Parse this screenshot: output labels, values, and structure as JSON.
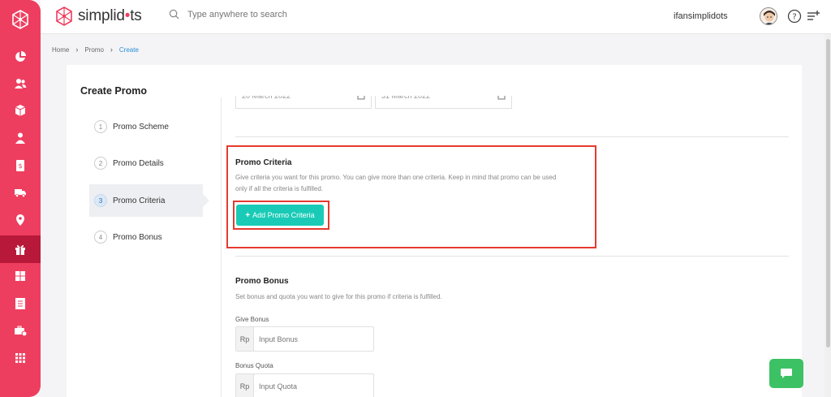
{
  "brand": {
    "name_prefix": "simplid",
    "name_dot": "•",
    "name_suffix": "ts",
    "accent_color": "#ee3e5f",
    "logo_icon": "network-hexagon-logo"
  },
  "search": {
    "placeholder": "Type anywhere to search",
    "icon": "search-icon"
  },
  "user": {
    "username": "ifansimplidots",
    "avatar_icon": "avatar-icon",
    "help_icon": "help-icon",
    "menu_icon": "menu-add-icon"
  },
  "sidebar": {
    "items": [
      {
        "icon": "pie-chart-icon"
      },
      {
        "icon": "users-icon"
      },
      {
        "icon": "box-icon"
      },
      {
        "icon": "user-badge-icon"
      },
      {
        "icon": "invoice-icon"
      },
      {
        "icon": "truck-icon"
      },
      {
        "icon": "map-pin-icon"
      },
      {
        "icon": "gift-icon",
        "active": true
      },
      {
        "icon": "package-grid-icon"
      },
      {
        "icon": "list-doc-icon"
      },
      {
        "icon": "briefcase-icon"
      },
      {
        "icon": "apps-grid-icon"
      }
    ]
  },
  "breadcrumb": {
    "home": "Home",
    "promo": "Promo",
    "current": "Create"
  },
  "page": {
    "title": "Create Promo",
    "steps": [
      {
        "num": "1",
        "label": "Promo Scheme"
      },
      {
        "num": "2",
        "label": "Promo Details"
      },
      {
        "num": "3",
        "label": "Promo Criteria",
        "active": true
      },
      {
        "num": "4",
        "label": "Promo Bonus"
      }
    ]
  },
  "dates": {
    "start": "20 March 2022",
    "end": "31 March 2022"
  },
  "criteria": {
    "title": "Promo Criteria",
    "description": "Give criteria you want for this promo. You can give more than one criteria. Keep in mind that promo can be used only if all the criteria is fulfilled.",
    "button_label": "Add Promo Criteria",
    "button_icon": "+"
  },
  "bonus": {
    "title": "Promo Bonus",
    "description": "Set bonus and quota you want to give for this promo if criteria is fulfilled.",
    "give_bonus_label": "Give Bonus",
    "currency_prefix": "Rp",
    "bonus_placeholder": "Input Bonus",
    "quota_label": "Bonus Quota",
    "quota_prefix": "Rp",
    "quota_placeholder": "Input Quota"
  },
  "colors": {
    "highlight": "#e53a2f",
    "primary_button": "#19cbb6",
    "chat_button": "#3cc265",
    "link": "#2a8fd6"
  }
}
